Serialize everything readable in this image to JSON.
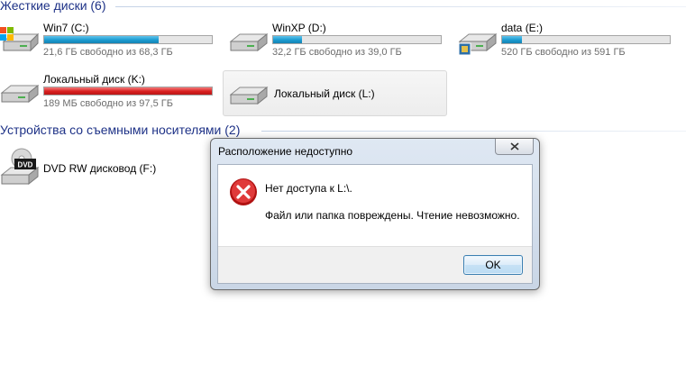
{
  "groups": {
    "hard_disks": "Жесткие диски (6)",
    "removable": "Устройства со съемными носителями (2)"
  },
  "drives": [
    {
      "name": "Win7 (C:)",
      "free_text": "21,6 ГБ свободно из 68,3 ГБ",
      "used_fraction": 0.684,
      "bar_color": "#1b9bd0",
      "icon": "windows-drive-icon"
    },
    {
      "name": "WinXP (D:)",
      "free_text": "32,2 ГБ свободно из 39,0 ГБ",
      "used_fraction": 0.174,
      "bar_color": "#1b9bd0",
      "icon": "hard-drive-icon"
    },
    {
      "name": "data (E:)",
      "free_text": "520 ГБ свободно из 591 ГБ",
      "used_fraction": 0.12,
      "bar_color": "#1b9bd0",
      "icon": "hard-drive-media-icon"
    },
    {
      "name": "Локальный диск (K:)",
      "free_text": "189 МБ свободно из 97,5 ГБ",
      "used_fraction": 0.998,
      "bar_color": "#d91f1f",
      "icon": "hard-drive-icon"
    },
    {
      "name": "Локальный диск (L:)",
      "icon": "hard-drive-icon",
      "selected": true
    }
  ],
  "removable_drives": [
    {
      "name": "DVD RW дисковод (F:)",
      "icon": "dvd-drive-icon",
      "icon_text": "DVD"
    }
  ],
  "dialog": {
    "title": "Расположение недоступно",
    "message_line1": "Нет доступа к L:\\.",
    "message_line2": "Файл или папка повреждены. Чтение невозможно.",
    "ok_label": "OK",
    "icon": "error-icon",
    "close_icon": "close-icon"
  },
  "colors": {
    "group_header": "#1e3287",
    "bar_normal": "#1b9bd0",
    "bar_full": "#d91f1f",
    "error_red": "#d21c1c"
  }
}
